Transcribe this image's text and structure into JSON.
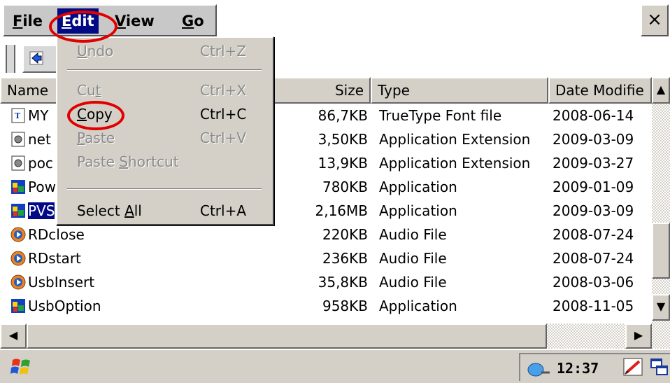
{
  "menubar": {
    "items": [
      {
        "label_pre": "",
        "accel": "F",
        "label_post": "ile"
      },
      {
        "label_pre": "",
        "accel": "E",
        "label_post": "dit"
      },
      {
        "label_pre": "",
        "accel": "V",
        "label_post": "iew"
      },
      {
        "label_pre": "",
        "accel": "G",
        "label_post": "o"
      }
    ],
    "close_label": "×"
  },
  "columns": {
    "name": "Name",
    "size": "Size",
    "type": "Type",
    "date": "Date Modifie"
  },
  "files": [
    {
      "name": "MY",
      "size": "86,7KB",
      "type": "TrueType Font file",
      "date": "2008-06-14",
      "icon": "font-file-icon"
    },
    {
      "name": "net",
      "size": "3,50KB",
      "type": "Application Extension",
      "date": "2009-03-09",
      "icon": "dll-file-icon"
    },
    {
      "name": "poc",
      "size": "13,9KB",
      "type": "Application Extension",
      "date": "2009-03-27",
      "icon": "dll-file-icon"
    },
    {
      "name": "Pow",
      "size": "780KB",
      "type": "Application",
      "date": "2009-01-09",
      "icon": "application-icon"
    },
    {
      "name": "PVS",
      "size": "2,16MB",
      "type": "Application",
      "date": "2009-03-09",
      "icon": "application-icon"
    },
    {
      "name": "RDclose",
      "size": "220KB",
      "type": "Audio File",
      "date": "2008-07-24",
      "icon": "audio-file-icon"
    },
    {
      "name": "RDstart",
      "size": "236KB",
      "type": "Audio File",
      "date": "2008-07-24",
      "icon": "audio-file-icon"
    },
    {
      "name": "UsbInsert",
      "size": "35,8KB",
      "type": "Audio File",
      "date": "2008-03-06",
      "icon": "audio-file-icon"
    },
    {
      "name": "UsbOption",
      "size": "958KB",
      "type": "Application",
      "date": "2008-11-05",
      "icon": "application-icon"
    }
  ],
  "edit_menu": {
    "undo": {
      "pre": "",
      "accel": "U",
      "post": "ndo",
      "shortcut": "Ctrl+Z"
    },
    "cut": {
      "pre": "Cu",
      "accel": "t",
      "post": "",
      "shortcut": "Ctrl+X"
    },
    "copy": {
      "pre": "",
      "accel": "C",
      "post": "opy",
      "shortcut": "Ctrl+C"
    },
    "paste": {
      "pre": "",
      "accel": "P",
      "post": "aste",
      "shortcut": "Ctrl+V"
    },
    "paste_shortcut": {
      "pre": "Paste ",
      "accel": "S",
      "post": "hortcut",
      "shortcut": ""
    },
    "select_all": {
      "pre": "Select ",
      "accel": "A",
      "post": "ll",
      "shortcut": "Ctrl+A"
    }
  },
  "taskbar": {
    "clock": "12:37"
  },
  "colors": {
    "selection": "#000a84",
    "annotation_ring": "#e00000",
    "chrome": "#d4d0c8"
  }
}
